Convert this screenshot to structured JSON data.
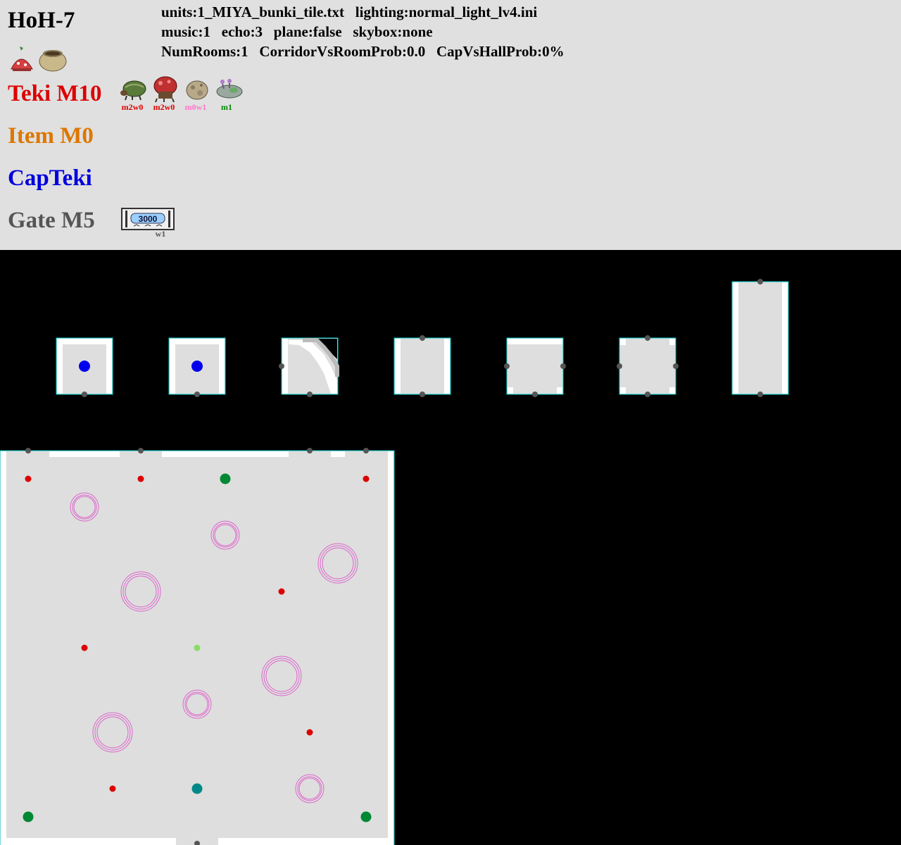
{
  "header": {
    "title": "HoH-7",
    "info_lines": [
      "units:1_MIYA_bunki_tile.txt   lighting:normal_light_lv4.ini",
      "music:1   echo:3   plane:false   skybox:none",
      "NumRooms:1   CorridorVsRoomProb:0.0   CapVsHallProb:0%"
    ],
    "treasure_icons": [
      "red-onion-treasure-icon",
      "sand-pot-treasure-icon"
    ],
    "teki": {
      "label": "Teki M10",
      "color": "#dd0000",
      "enemies": [
        {
          "icon": "armored-beetle-icon",
          "tag": "m2w0",
          "tag_color": "#dd0000"
        },
        {
          "icon": "red-mushroom-creature-icon",
          "tag": "m2w0",
          "tag_color": "#dd0000"
        },
        {
          "icon": "boulder-icon",
          "tag": "m0w1",
          "tag_color": "#ff77cc"
        },
        {
          "icon": "slug-creature-icon",
          "tag": "m1",
          "tag_color": "#008800"
        }
      ]
    },
    "item": {
      "label": "Item M0",
      "color": "#dd7700"
    },
    "capteki": {
      "label": "CapTeki",
      "color": "#0000dd"
    },
    "gate": {
      "label": "Gate M5",
      "color": "#555555",
      "gate_icon": "gate-icon",
      "gate_value": "3000",
      "gate_tag": "w1"
    }
  },
  "colors": {
    "header_bg": "#e0e0e0",
    "map_bg": "#000000",
    "floor": "#dedede",
    "wall": "#ffffff",
    "unit_border": "#00cccc",
    "door_marker": "#555555",
    "spawn_red": "#dd0000",
    "spawn_green": "#008833",
    "spawn_teal": "#008888",
    "spawn_light_green": "#88dd66",
    "spawn_blue": "#0000ee",
    "hazard_ring": "#dd66cc"
  }
}
